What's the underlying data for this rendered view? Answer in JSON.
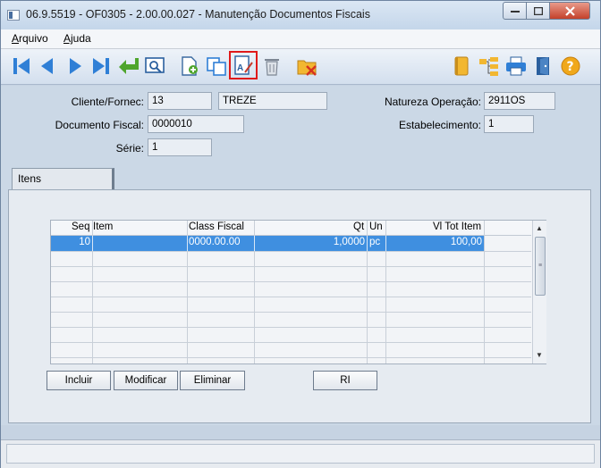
{
  "window": {
    "title": "06.9.5519 - OF0305 - 2.00.00.027 - Manutenção Documentos Fiscais",
    "minimize_icon": "minimize-icon",
    "maximize_icon": "maximize-icon",
    "close_icon": "close-icon"
  },
  "menu": {
    "items": [
      {
        "label_first": "A",
        "label_rest": "rquivo"
      },
      {
        "label_first": "Aj",
        "label_rest": "uda"
      }
    ]
  },
  "toolbar": {
    "buttons": [
      {
        "icon": "first-record-icon"
      },
      {
        "icon": "previous-record-icon"
      },
      {
        "icon": "next-record-icon"
      },
      {
        "icon": "last-record-icon"
      },
      {
        "icon": "go-to-icon"
      },
      {
        "icon": "search-icon"
      },
      {
        "icon": "new-record-icon"
      },
      {
        "icon": "copy-record-icon"
      },
      {
        "icon": "modify-record-icon"
      },
      {
        "icon": "delete-record-icon"
      },
      {
        "icon": "cancel-record-icon"
      },
      {
        "icon": "notes-icon"
      },
      {
        "icon": "tree-icon"
      },
      {
        "icon": "print-icon"
      },
      {
        "icon": "exit-icon"
      },
      {
        "icon": "help-icon"
      }
    ],
    "help_glyph": "?"
  },
  "form": {
    "cliente_label": "Cliente/Fornec:",
    "cliente_code": "13",
    "cliente_name": "TREZE",
    "natureza_label": "Natureza Operação:",
    "natureza_value": "2911OS",
    "documento_label": "Documento Fiscal:",
    "documento_value": "0000010",
    "estabelecimento_label": "Estabelecimento:",
    "estabelecimento_value": "1",
    "serie_label": "Série:",
    "serie_value": "1"
  },
  "tabs": [
    {
      "label": "Itens"
    }
  ],
  "grid": {
    "columns": [
      "Seq",
      "Item",
      "Class Fiscal",
      "Qt",
      "Un",
      "Vl Tot Item"
    ],
    "rows": [
      {
        "seq": "10",
        "item": "",
        "class_fiscal": "0000.00.00",
        "qt": "1,0000",
        "un": "pc",
        "vl_tot_item": "100,00"
      }
    ]
  },
  "buttons": {
    "incluir": "Incluir",
    "modificar": "Modificar",
    "eliminar": "Eliminar",
    "ri": "RI"
  },
  "colors": {
    "selection": "#3f8fe0",
    "highlight_border": "#e01a1a"
  }
}
